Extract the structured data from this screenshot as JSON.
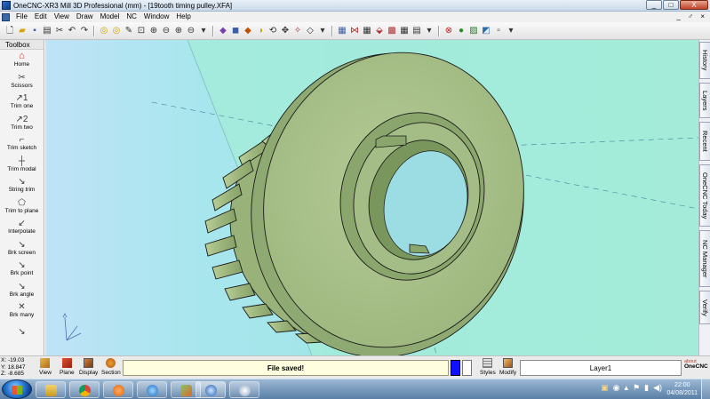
{
  "window": {
    "title": "OneCNC-XR3 Mill 3D Professional (mm) - [19tooth timing pulley.XFA]",
    "controls": [
      "_",
      "□",
      "X"
    ]
  },
  "menubar": {
    "items": [
      "File",
      "Edit",
      "View",
      "Draw",
      "Model",
      "NC",
      "Window",
      "Help"
    ],
    "mdi_controls": "_ ♂ ×"
  },
  "toolbox": {
    "title": "Toolbox",
    "tools": [
      {
        "label": "Home",
        "icon": "house-icon"
      },
      {
        "label": "Scissors",
        "icon": "scissors-icon"
      },
      {
        "label": "Trim one",
        "icon": "trim-one-icon"
      },
      {
        "label": "Trim two",
        "icon": "trim-two-icon"
      },
      {
        "label": "Trim sketch",
        "icon": "trim-sketch-icon"
      },
      {
        "label": "Trim modal",
        "icon": "trim-modal-icon"
      },
      {
        "label": "String trim",
        "icon": "string-trim-icon"
      },
      {
        "label": "Trim to plane",
        "icon": "trim-plane-icon"
      },
      {
        "label": "Interpolate",
        "icon": "interpolate-icon"
      },
      {
        "label": "Brk screen",
        "icon": "break-screen-icon"
      },
      {
        "label": "Brk point",
        "icon": "break-point-icon"
      },
      {
        "label": "Brk angle",
        "icon": "break-angle-icon"
      },
      {
        "label": "Brk many",
        "icon": "break-many-icon"
      }
    ]
  },
  "side_tabs": [
    "History",
    "Layers",
    "Recent",
    "OneCNC Today",
    "NC Manager",
    "Verify"
  ],
  "status": {
    "coords": {
      "x": "X: -19.03",
      "y": "Y: 18.847",
      "z": "Z: -8.685"
    },
    "buttons": [
      "View",
      "Plane",
      "Display",
      "Section"
    ],
    "message": "File saved!",
    "styles_label": "Styles",
    "modify_label": "Modify",
    "layer": "Layer1",
    "about_small": "about",
    "about_brand": "OneCNC"
  },
  "taskbar": {
    "time": "22:00",
    "date": "04/08/2011",
    "apps": [
      "windows-explorer",
      "chrome",
      "media-player",
      "internet-explorer",
      "app",
      "onecnc",
      "app2"
    ]
  },
  "colors": {
    "viewport_bg": "#9fe5e6",
    "part_face": "#a9c08a",
    "part_edge": "#1a1a1a",
    "message_bg": "#ffffe0",
    "layer_color": "#1010ff"
  }
}
